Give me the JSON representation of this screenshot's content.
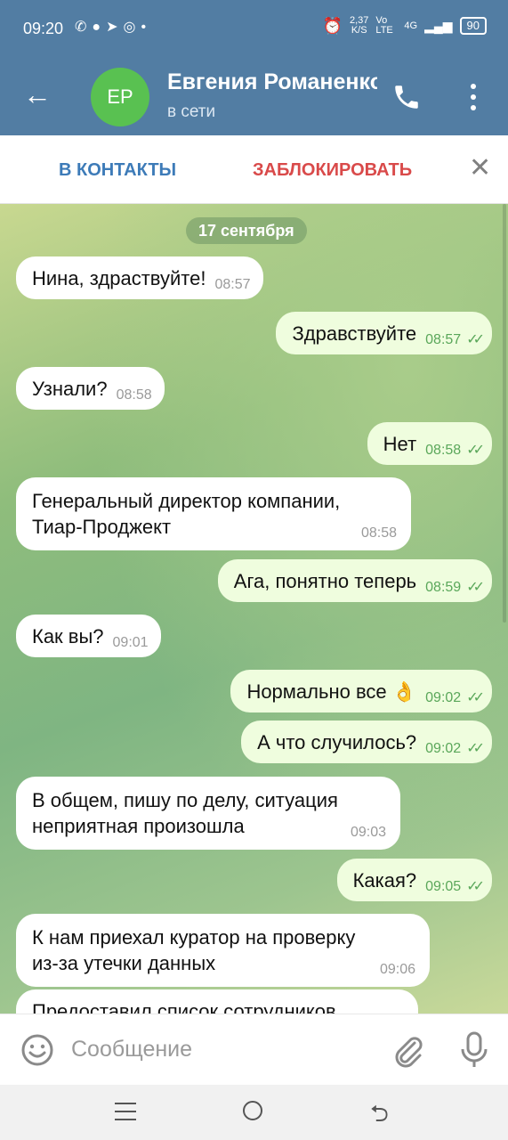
{
  "status_bar": {
    "time": "09:20",
    "speed": "2,37",
    "speed_unit": "K/S",
    "net1": "Vo LTE",
    "net2": "4G",
    "battery": "90"
  },
  "header": {
    "contact_initials": "ЕР",
    "contact_name": "Евгения Романенко",
    "status": "в сети",
    "accent": "#527da3"
  },
  "action_bar": {
    "add_contact_label": "В КОНТАКТЫ",
    "block_label": "ЗАБЛОКИРОВАТЬ",
    "close_symbol": "✕"
  },
  "chat": {
    "date": "17 сентября",
    "messages": [
      {
        "dir": "in",
        "text": "Нина, здраствуйте!",
        "time": "08:57"
      },
      {
        "dir": "out",
        "text": "Здравствуйте",
        "time": "08:57",
        "read": "✓✓"
      },
      {
        "dir": "in",
        "text": "Узнали?",
        "time": "08:58"
      },
      {
        "dir": "out",
        "text": "Нет",
        "time": "08:58",
        "read": "✓✓"
      },
      {
        "dir": "in",
        "lines": [
          "Генеральный директор компании,",
          "Тиар-Проджект"
        ],
        "time": "08:58"
      },
      {
        "dir": "out",
        "text": "Ага, понятно теперь",
        "time": "08:59",
        "read": "✓✓"
      },
      {
        "dir": "in",
        "text": "Как вы?",
        "time": "09:01"
      },
      {
        "dir": "out",
        "text": "Нормально все 👌",
        "time": "09:02",
        "read": "✓✓"
      },
      {
        "dir": "out",
        "text": "А что случилось?",
        "time": "09:02",
        "read": "✓✓"
      },
      {
        "dir": "in",
        "lines": [
          "В общем, пишу по делу, ситуация",
          "неприятная произошла"
        ],
        "time": "09:03"
      },
      {
        "dir": "out",
        "text": "Какая?",
        "time": "09:05",
        "read": "✓✓"
      },
      {
        "dir": "in",
        "lines": [
          "К нам приехал куратор на проверку",
          "из-за утечки данных"
        ],
        "time": "09:06"
      },
      {
        "dir": "in",
        "text": "Предоставил список сотрудников"
      }
    ]
  },
  "input": {
    "placeholder": "Сообщение"
  }
}
